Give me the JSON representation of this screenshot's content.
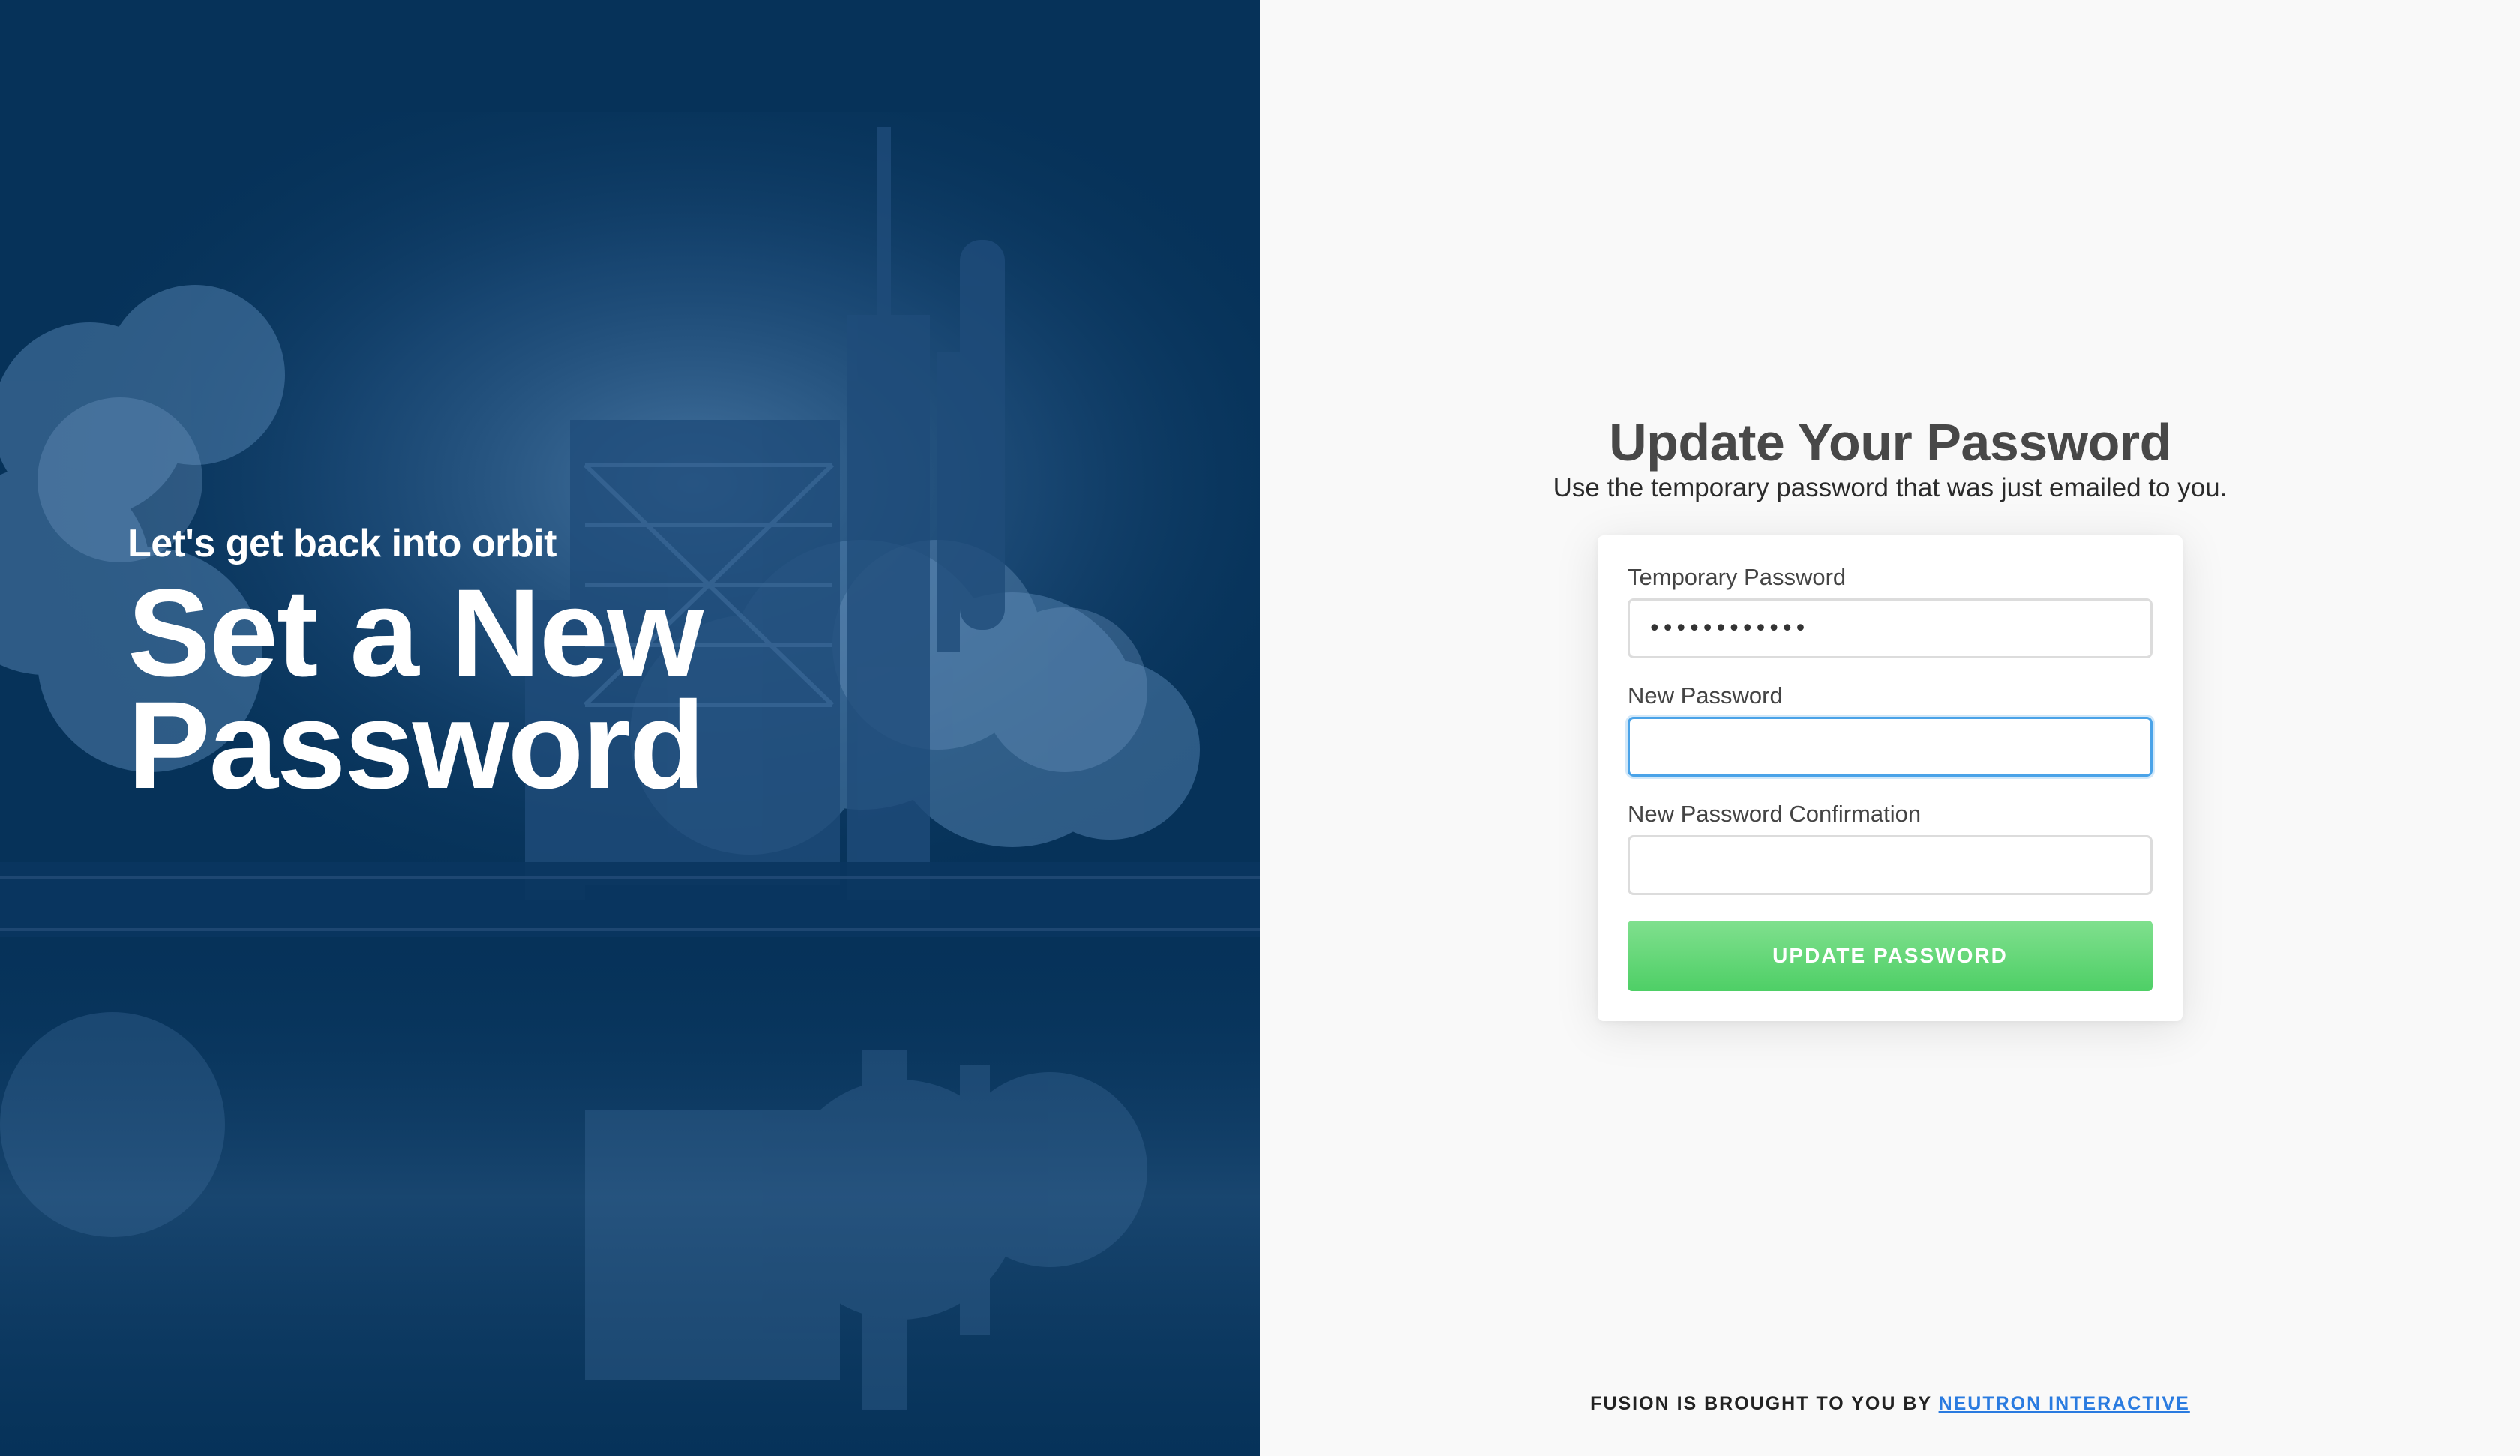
{
  "hero": {
    "subtitle": "Let's get back into orbit",
    "title": "Set a New Password"
  },
  "form": {
    "heading": "Update Your Password",
    "subheading": "Use the temporary password that was just emailed to you.",
    "fields": [
      {
        "label": "Temporary Password",
        "value": "••••••••••••",
        "placeholder": ""
      },
      {
        "label": "New Password",
        "value": "",
        "placeholder": ""
      },
      {
        "label": "New Password Confirmation",
        "value": "",
        "placeholder": ""
      }
    ],
    "submit_label": "UPDATE PASSWORD"
  },
  "footer": {
    "credit_prefix": "FUSION IS BROUGHT TO YOU BY",
    "credit_link": "NEUTRON INTERACTIVE"
  },
  "colors": {
    "hero_bg": "#063259",
    "panel_bg": "#f9f9f9",
    "accent_green": "#4ecf66",
    "focus_blue": "#4aa3e8",
    "link_blue": "#2a7be0"
  }
}
